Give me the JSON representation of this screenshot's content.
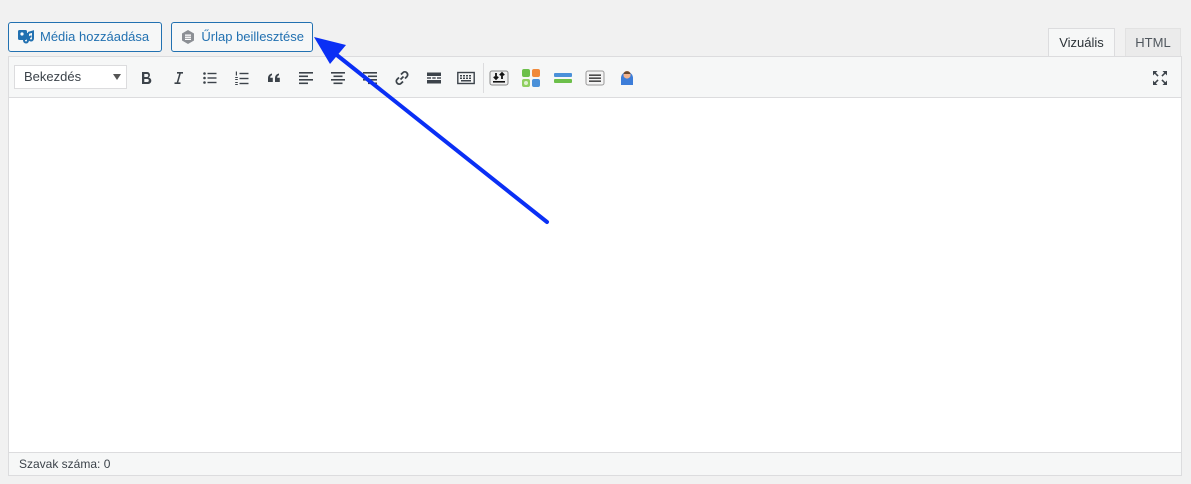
{
  "media_buttons": {
    "add_media_label": "Média hozzáadása",
    "insert_form_label": "Űrlap beillesztése"
  },
  "tabs": {
    "visual_label": "Vizuális",
    "html_label": "HTML"
  },
  "toolbar": {
    "format_select_value": "Bekezdés",
    "buttons": [
      "bold",
      "italic",
      "bulleted-list",
      "numbered-list",
      "blockquote",
      "align-left",
      "align-center",
      "align-right",
      "insert-link",
      "read-more",
      "toolbar-toggle",
      "plugin-download",
      "plugin-grid",
      "plugin-bar",
      "plugin-form",
      "plugin-user",
      "fullscreen"
    ]
  },
  "statusbar": {
    "word_count_label": "Szavak száma: 0"
  },
  "colors": {
    "accent": "#2271b1",
    "annotation_arrow": "#0a2ff5"
  }
}
